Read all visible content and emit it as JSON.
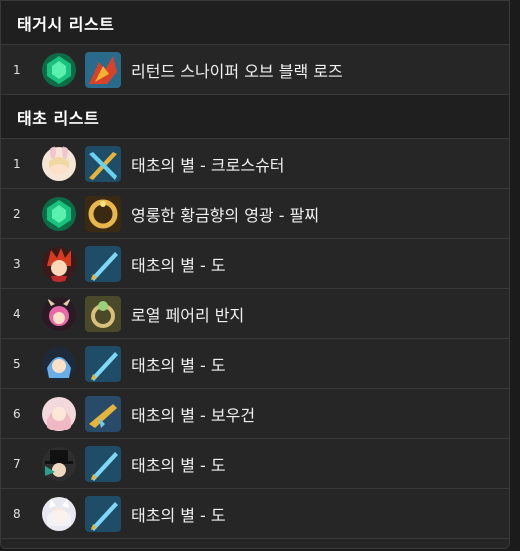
{
  "sections": [
    {
      "title": "태거시 리스트",
      "rows": [
        {
          "rank": "1",
          "avatar": "emerald-icon",
          "item": "dragon-icon",
          "label": "리턴드 스나이퍼 오브 블랙 로즈"
        }
      ]
    },
    {
      "title": "태초 리스트",
      "rows": [
        {
          "rank": "1",
          "avatar": "bunny-girl-icon",
          "item": "twin-blades-icon",
          "label": "태초의 별 - 크로스슈터"
        },
        {
          "rank": "2",
          "avatar": "emerald-icon",
          "item": "bracelet-icon",
          "label": "영롱한 황금향의 영광 - 팔찌"
        },
        {
          "rank": "3",
          "avatar": "fire-hair-icon",
          "item": "sword-icon",
          "label": "태초의 별 - 도"
        },
        {
          "rank": "4",
          "avatar": "pink-horns-icon",
          "item": "ring-icon",
          "label": "로열 페어리 반지"
        },
        {
          "rank": "5",
          "avatar": "blue-hair-icon",
          "item": "sword-icon",
          "label": "태초의 별 - 도"
        },
        {
          "rank": "6",
          "avatar": "pink-hair-icon",
          "item": "gun-icon",
          "label": "태초의 별 - 보우건"
        },
        {
          "rank": "7",
          "avatar": "top-hat-icon",
          "item": "sword-icon",
          "label": "태초의 별 - 도"
        },
        {
          "rank": "8",
          "avatar": "white-fox-icon",
          "item": "sword-icon",
          "label": "태초의 별 - 도"
        }
      ]
    }
  ]
}
